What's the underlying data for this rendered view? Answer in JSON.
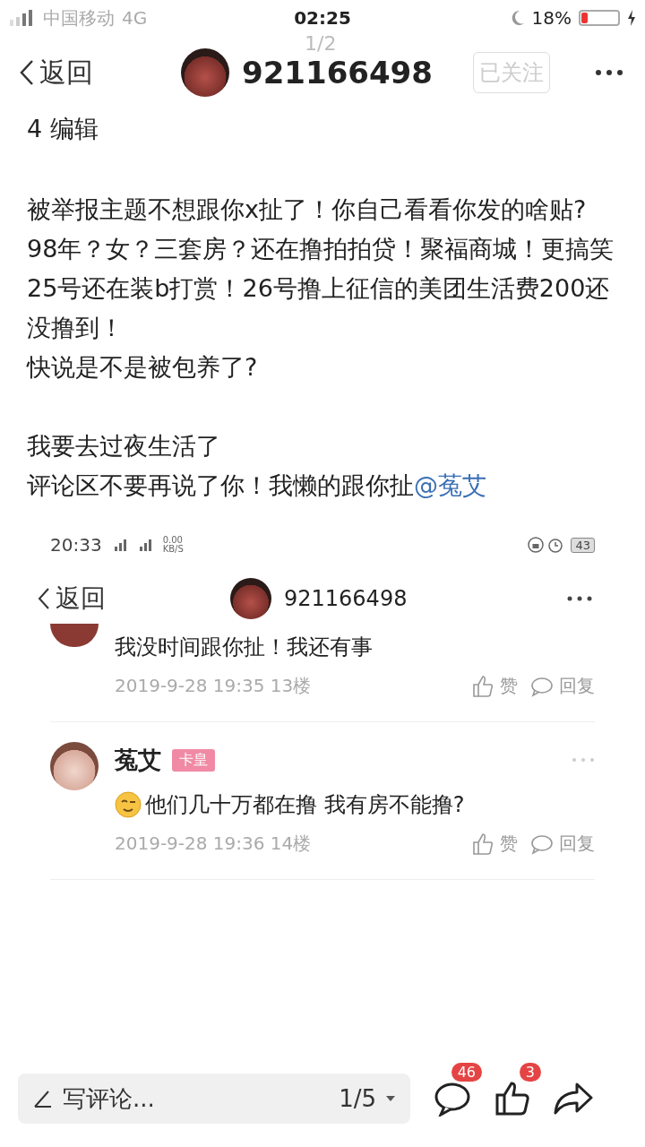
{
  "status_bar": {
    "carrier": "中国移动",
    "network": "4G",
    "time": "02:25",
    "battery": "18%"
  },
  "page_indicator": "1/2",
  "header": {
    "back": "返回",
    "username": "921166498",
    "follow": "已关注",
    "followed": true
  },
  "post": {
    "paragraphs": [
      [
        "4 编辑"
      ],
      [
        "被举报主题不想跟你x扯了！你自己看看你发的啥贴?",
        "98年？女？三套房？还在撸拍拍贷！聚福商城！更搞笑25号还在装b打赏！26号撸上征信的美团生活费200还没撸到！",
        "快说是不是被包养了?"
      ],
      [
        "我要去过夜生活了"
      ]
    ],
    "last_line": "评论区不要再说了你！我懒的跟你扯",
    "mention": "@菟艾"
  },
  "inner": {
    "status_bar": {
      "time": "20:33",
      "speed": "0.00",
      "speed_unit": "KB/S",
      "battery": "43"
    },
    "header": {
      "back": "返回",
      "username": "921166498"
    },
    "comments": [
      {
        "text": "我没时间跟你扯！我还有事",
        "meta": "2019-9-28 19:35  13楼",
        "like": "赞",
        "reply": "回复",
        "emoji": false
      },
      {
        "author": "菟艾",
        "badge": "卡皇",
        "text": "他们几十万都在撸 我有房不能撸?",
        "meta": "2019-9-28 19:36  14楼",
        "like": "赞",
        "reply": "回复",
        "emoji": true
      }
    ]
  },
  "bottom_bar": {
    "placeholder": "写评论...",
    "page": "1/5",
    "comment_count": "46",
    "like_count": "3"
  }
}
